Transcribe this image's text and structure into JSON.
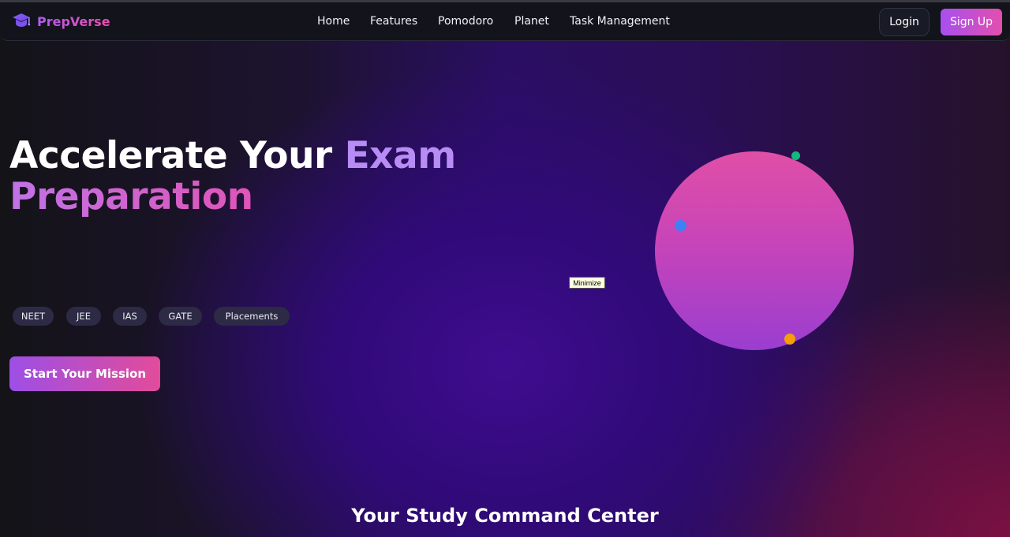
{
  "brand": {
    "name": "PrepVerse",
    "icon": "graduation-cap-icon"
  },
  "nav": {
    "links": [
      "Home",
      "Features",
      "Pomodoro",
      "Planet",
      "Task Management"
    ],
    "login_label": "Login",
    "signup_label": "Sign Up"
  },
  "hero": {
    "title_line1_white": "Accelerate Your ",
    "title_line1_accent": "Exam",
    "title_line2_accent": "Preparation",
    "tags": [
      "NEET",
      "JEE",
      "IAS",
      "GATE",
      "Placements"
    ],
    "cta_label": "Start Your Mission"
  },
  "tooltip": {
    "text": "Minimize"
  },
  "planet": {
    "orbit_dot_colors": [
      "#10b981",
      "#3b82f6",
      "#f59e0b"
    ]
  },
  "section": {
    "title": "Your Study Command Center"
  },
  "colors": {
    "accent_purple": "#a84ff0",
    "accent_pink": "#e24fae",
    "nav_bg": "#12131b"
  }
}
